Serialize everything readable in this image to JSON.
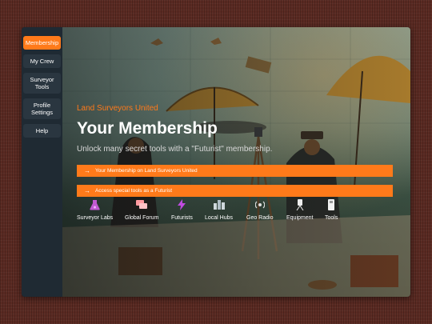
{
  "sidebar": {
    "items": [
      {
        "label": "Membership",
        "active": true
      },
      {
        "label": "My Crew"
      },
      {
        "label": "Surveyor Tools"
      },
      {
        "label": "Profile Settings"
      },
      {
        "label": "Help"
      }
    ]
  },
  "hero": {
    "kicker": "Land Surveyors United",
    "title": "Your Membership",
    "subtitle": "Unlock many secret tools with a \"Futurist\" membership."
  },
  "actions": {
    "membership": "Your Membership on Land Surveyors United",
    "special_tools": "Access special tools as a Futurist",
    "arrow": "→"
  },
  "tools": [
    {
      "label": "Surveyor Labs",
      "icon": "flask-icon"
    },
    {
      "label": "Global Forum",
      "icon": "forum-icon"
    },
    {
      "label": "Futurists",
      "icon": "lightning-icon"
    },
    {
      "label": "Local Hubs",
      "icon": "hubs-icon"
    },
    {
      "label": "Geo Radio",
      "icon": "radio-icon"
    },
    {
      "label": "Equipment",
      "icon": "equipment-icon"
    },
    {
      "label": "Tools",
      "icon": "tools-icon"
    }
  ],
  "colors": {
    "accent": "#ff7a1a",
    "sidebar": "#1f2a33",
    "backdrop": "#5a2a22"
  }
}
